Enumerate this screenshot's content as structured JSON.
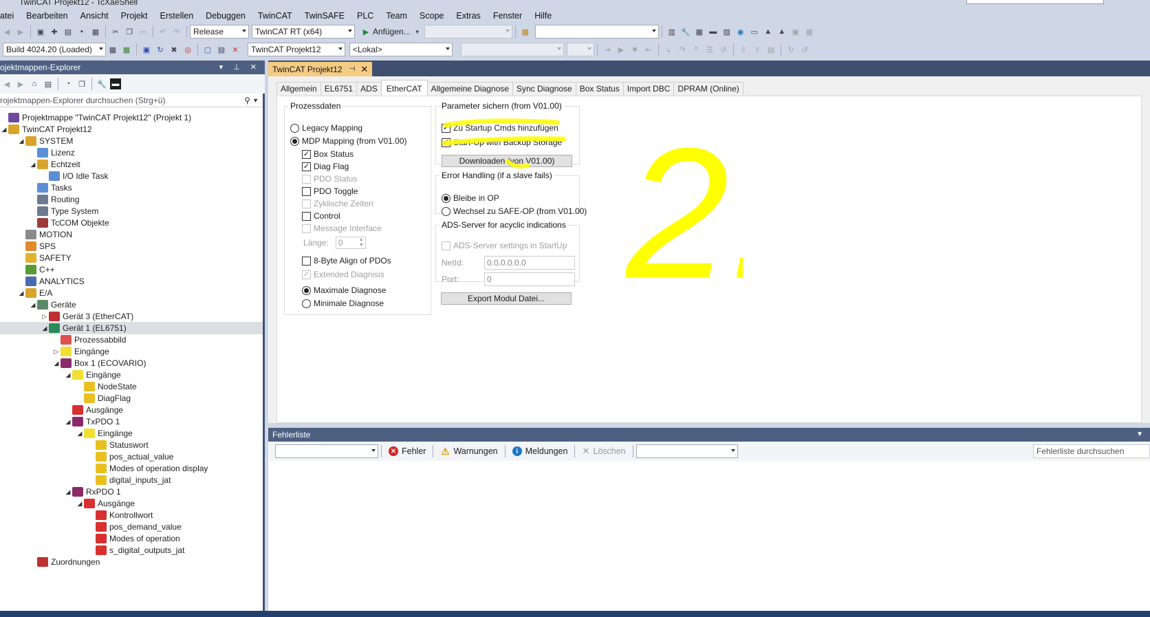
{
  "window": {
    "title": "TwinCAT Projekt12 - TcXaeShell"
  },
  "menu": [
    "atei",
    "Bearbeiten",
    "Ansicht",
    "Projekt",
    "Erstellen",
    "Debuggen",
    "TwinCAT",
    "TwinSAFE",
    "PLC",
    "Team",
    "Scope",
    "Extras",
    "Fenster",
    "Hilfe"
  ],
  "toolbar": {
    "config": "Release",
    "platform": "TwinCAT RT (x64)",
    "attach": "Anfügen...",
    "build": "Build 4024.20 (Loaded)",
    "project": "TwinCAT Projekt12",
    "target": "<Lokal>"
  },
  "solution": {
    "title": "ojektmappen-Explorer",
    "search_placeholder": "rojektmappen-Explorer durchsuchen (Strg+ü)",
    "tree": [
      {
        "label": "Projektmappe \"TwinCAT Projekt12\" (Projekt 1)",
        "level": 0,
        "exp": "",
        "icon": "solution",
        "color": "#6c4aa0"
      },
      {
        "label": "TwinCAT Projekt12",
        "level": 0,
        "exp": "◢",
        "icon": "project",
        "color": "#d9a42a"
      },
      {
        "label": "SYSTEM",
        "level": 1,
        "exp": "◢",
        "icon": "system",
        "color": "#d9a42a"
      },
      {
        "label": "Lizenz",
        "level": 2,
        "exp": "",
        "icon": "license",
        "color": "#5a8fd6"
      },
      {
        "label": "Echtzeit",
        "level": 2,
        "exp": "◢",
        "icon": "realtime",
        "color": "#d9a42a"
      },
      {
        "label": "I/O Idle Task",
        "level": 3,
        "exp": "",
        "icon": "task",
        "color": "#5a8fd6"
      },
      {
        "label": "Tasks",
        "level": 2,
        "exp": "",
        "icon": "tasks",
        "color": "#5a8fd6"
      },
      {
        "label": "Routing",
        "level": 2,
        "exp": "",
        "icon": "routing",
        "color": "#6d7a90"
      },
      {
        "label": "Type System",
        "level": 2,
        "exp": "",
        "icon": "types",
        "color": "#6d7a90"
      },
      {
        "label": "TcCOM Objekte",
        "level": 2,
        "exp": "",
        "icon": "tccom",
        "color": "#9b3b3b"
      },
      {
        "label": "MOTION",
        "level": 1,
        "exp": "",
        "icon": "motion",
        "color": "#8a8a8a"
      },
      {
        "label": "SPS",
        "level": 1,
        "exp": "",
        "icon": "plc",
        "color": "#e08a2e"
      },
      {
        "label": "SAFETY",
        "level": 1,
        "exp": "",
        "icon": "safety",
        "color": "#e0b22e"
      },
      {
        "label": "C++",
        "level": 1,
        "exp": "",
        "icon": "cpp",
        "color": "#5a9a3a"
      },
      {
        "label": "ANALYTICS",
        "level": 1,
        "exp": "",
        "icon": "analytics",
        "color": "#4a6ab0"
      },
      {
        "label": "E/A",
        "level": 1,
        "exp": "◢",
        "icon": "io",
        "color": "#d9a42a"
      },
      {
        "label": "Geräte",
        "level": 2,
        "exp": "◢",
        "icon": "devices",
        "color": "#5a8a6a"
      },
      {
        "label": "Gerät 3 (EtherCAT)",
        "level": 3,
        "exp": "▷",
        "icon": "ethercat",
        "color": "#c03030"
      },
      {
        "label": "Gerät 1 (EL6751)",
        "level": 3,
        "exp": "◢",
        "icon": "canopen",
        "color": "#2a8a5a",
        "selected": true
      },
      {
        "label": "Prozessabbild",
        "level": 4,
        "exp": "",
        "icon": "image",
        "color": "#e05050"
      },
      {
        "label": "Eingänge",
        "level": 4,
        "exp": "▷",
        "icon": "inputs",
        "color": "#f2e033"
      },
      {
        "label": "Box 1 (ECOVARIO)",
        "level": 4,
        "exp": "◢",
        "icon": "box",
        "color": "#8a2a6a"
      },
      {
        "label": "Eingänge",
        "level": 5,
        "exp": "◢",
        "icon": "inputs",
        "color": "#f2e033"
      },
      {
        "label": "NodeState",
        "level": 6,
        "exp": "",
        "icon": "var-in",
        "color": "#e8c020"
      },
      {
        "label": "DiagFlag",
        "level": 6,
        "exp": "",
        "icon": "var-in",
        "color": "#e8c020"
      },
      {
        "label": "Ausgänge",
        "level": 5,
        "exp": "",
        "icon": "outputs",
        "color": "#d83030"
      },
      {
        "label": "TxPDO 1",
        "level": 5,
        "exp": "◢",
        "icon": "pdo",
        "color": "#8a2a6a"
      },
      {
        "label": "Eingänge",
        "level": 6,
        "exp": "◢",
        "icon": "inputs",
        "color": "#f2e033"
      },
      {
        "label": "Statuswort",
        "level": 7,
        "exp": "",
        "icon": "var-in",
        "color": "#e8c020"
      },
      {
        "label": "pos_actual_value",
        "level": 7,
        "exp": "",
        "icon": "var-in",
        "color": "#e8c020"
      },
      {
        "label": "Modes of operation display",
        "level": 7,
        "exp": "",
        "icon": "var-in",
        "color": "#e8c020"
      },
      {
        "label": "digital_inputs_jat",
        "level": 7,
        "exp": "",
        "icon": "var-in",
        "color": "#e8c020"
      },
      {
        "label": "RxPDO 1",
        "level": 5,
        "exp": "◢",
        "icon": "pdo",
        "color": "#8a2a6a"
      },
      {
        "label": "Ausgänge",
        "level": 6,
        "exp": "◢",
        "icon": "outputs",
        "color": "#d83030"
      },
      {
        "label": "Kontrollwort",
        "level": 7,
        "exp": "",
        "icon": "var-out",
        "color": "#d83030"
      },
      {
        "label": "pos_demand_value",
        "level": 7,
        "exp": "",
        "icon": "var-out",
        "color": "#d83030"
      },
      {
        "label": "Modes of operation",
        "level": 7,
        "exp": "",
        "icon": "var-out",
        "color": "#d83030"
      },
      {
        "label": "s_digital_outputs_jat",
        "level": 7,
        "exp": "",
        "icon": "var-out",
        "color": "#d83030"
      },
      {
        "label": "Zuordnungen",
        "level": 2,
        "exp": "",
        "icon": "mapping",
        "color": "#c03030"
      }
    ]
  },
  "editor": {
    "doc_tab": "TwinCAT Projekt12",
    "tabs": [
      "Allgemein",
      "EL6751",
      "ADS",
      "EtherCAT",
      "Allgemeine Diagnose",
      "Sync Diagnose",
      "Box Status",
      "Import DBC",
      "DPRAM (Online)"
    ],
    "active_tab": "EtherCAT",
    "prozessdaten": {
      "title": "Prozessdaten",
      "legacy": "Legacy Mapping",
      "mdp": "MDP Mapping (from V01.00)",
      "box_status": "Box Status",
      "diag_flag": "Diag Flag",
      "pdo_status": "PDO Status",
      "pdo_toggle": "PDO Toggle",
      "zyklische": "Zyklische Zeiten",
      "control": "Control",
      "message": "Message Interface",
      "laenge_label": "Länge:",
      "laenge_value": "0",
      "align": "8-Byte Align of PDOs",
      "extended": "Extended Diagnisis",
      "maximale": "Maximale Diagnose",
      "minimale": "Minimale Diagnose"
    },
    "parameter": {
      "title": "Parameter sichern (from V01.00)",
      "startup_cmds": "Zu Startup Cmds hinzufügen",
      "backup": "Start-Up with Backup Storage",
      "download": "Downloaden (von V01.00)"
    },
    "error_handling": {
      "title": "Error Handling (if a slave fails)",
      "bleibe": "Bleibe in OP",
      "wechsel": "Wechsel zu SAFE-OP (from V01.00)"
    },
    "ads_server": {
      "title": "ADS-Server for acyclic indications",
      "settings": "ADS-Server settings in StartUp",
      "netid_label": "NetId:",
      "netid_value": "0.0.0.0.0.0",
      "port_label": "Port:",
      "port_value": "0"
    },
    "export_button": "Export Modul Datei..."
  },
  "errorlist": {
    "title": "Fehlerliste",
    "fehler": "Fehler",
    "warnungen": "Warnungen",
    "meldungen": "Meldungen",
    "loeschen": "Löschen",
    "search_placeholder": "Fehlerliste durchsuchen"
  },
  "annotation": {
    "text": "2.",
    "color": "#ffff00"
  }
}
